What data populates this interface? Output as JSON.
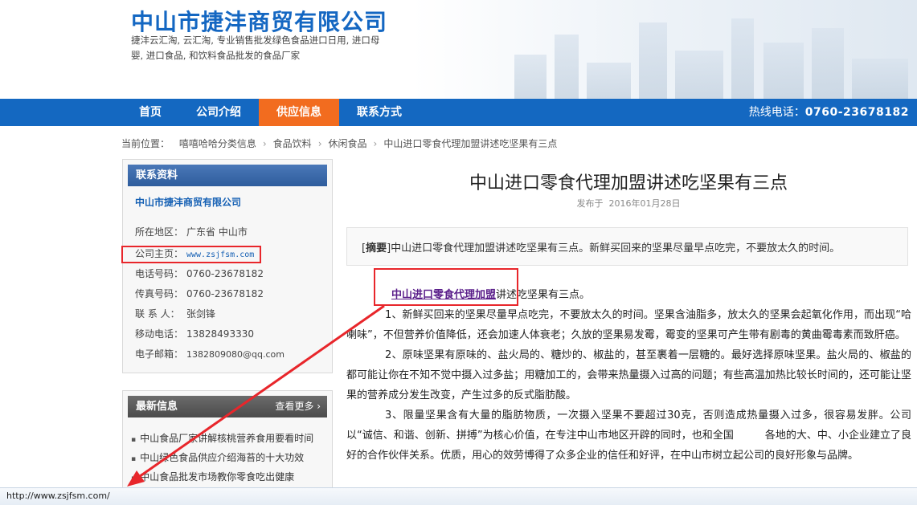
{
  "header": {
    "company_name": "中山市捷沣商贸有限公司",
    "description": "捷沣云汇淘, 云汇淘, 专业销售批发绿色食品进口日用, 进口母婴, 进口食品, 和饮料食品批发的食品厂家"
  },
  "nav": {
    "items": [
      "首页",
      "公司介绍",
      "供应信息",
      "联系方式"
    ],
    "active": "供应信息",
    "hotline_label": "热线电话：",
    "hotline_number": "0760-23678182"
  },
  "breadcrumb": {
    "prefix": "当前位置：",
    "items": [
      "嘻嘻哈哈分类信息",
      "食品饮料",
      "休闲食品",
      "中山进口零食代理加盟讲述吃坚果有三点"
    ],
    "separator": "›"
  },
  "contact": {
    "title": "联系资料",
    "company": "中山市捷沣商贸有限公司",
    "rows": [
      {
        "label": "所在地区：",
        "value": "广东省 中山市"
      },
      {
        "label": "公司主页：",
        "value": "www.zsjfsm.com"
      },
      {
        "label": "电话号码：",
        "value": "0760-23678182"
      },
      {
        "label": "传真号码：",
        "value": "0760-23678182"
      },
      {
        "label": "联 系 人：",
        "value": "张剑锋"
      },
      {
        "label": "移动电话：",
        "value": "13828493330"
      },
      {
        "label": "电子邮箱：",
        "value": "1382809080@qq.com"
      }
    ]
  },
  "latest": {
    "title": "最新信息",
    "more": "查看更多",
    "items": [
      "中山食品厂家讲解核桃营养食用要看时间",
      "中山绿色食品供应介绍海苔的十大功效",
      "中山食品批发市场教你零食吃出健康"
    ]
  },
  "article": {
    "title": "中山进口零食代理加盟讲述吃坚果有三点",
    "date_label": "发布于",
    "date": "2016年01月28日",
    "summary_tag": "摘要",
    "summary": "中山进口零食代理加盟讲述吃坚果有三点。新鲜买回来的坚果尽量早点吃完，不要放太久的时间。",
    "link_text": "中山进口零食代理加盟",
    "link_tail": "讲述吃坚果有三点。",
    "paragraphs": [
      "1、新鲜买回来的坚果尽量早点吃完，不要放太久的时间。坚果含油脂多，放太久的坚果会起氧化作用，而出现“哈喇味”，不但营养价值降低，还会加速人体衰老；久放的坚果易发霉，霉变的坚果可产生带有剧毒的黄曲霉毒素而致肝癌。",
      "2、原味坚果有原味的、盐火局的、糖炒的、椒盐的，甚至裹着一层糖的。最好选择原味坚果。盐火局的、椒盐的都可能让你在不知不觉中摄入过多盐；用糖加工的，会带来热量摄入过高的问题；有些高温加热比较长时间的，还可能让坚果的营养成分发生改变，产生过多的反式脂肪酸。",
      "3、限量坚果含有大量的脂肪物质，一次摄入坚果不要超过30克，否则造成热量摄入过多，很容易发胖。公司以“诚信、和谐、创新、拼搏”为核心价值，在专注中山市地区开辟的同时，也和全国　　　各地的大、中、小企业建立了良好的合作伙伴关系。优质，用心的效劳博得了众多企业的信任和好评，在中山市树立起公司的良好形象与品牌。"
    ]
  },
  "statusbar": {
    "url": "http://www.zsjfsm.com/"
  },
  "colors": {
    "nav_blue": "#1468c1",
    "nav_active": "#f26c1f",
    "title_blue": "#1467c2",
    "annotation_red": "#e8262b"
  }
}
